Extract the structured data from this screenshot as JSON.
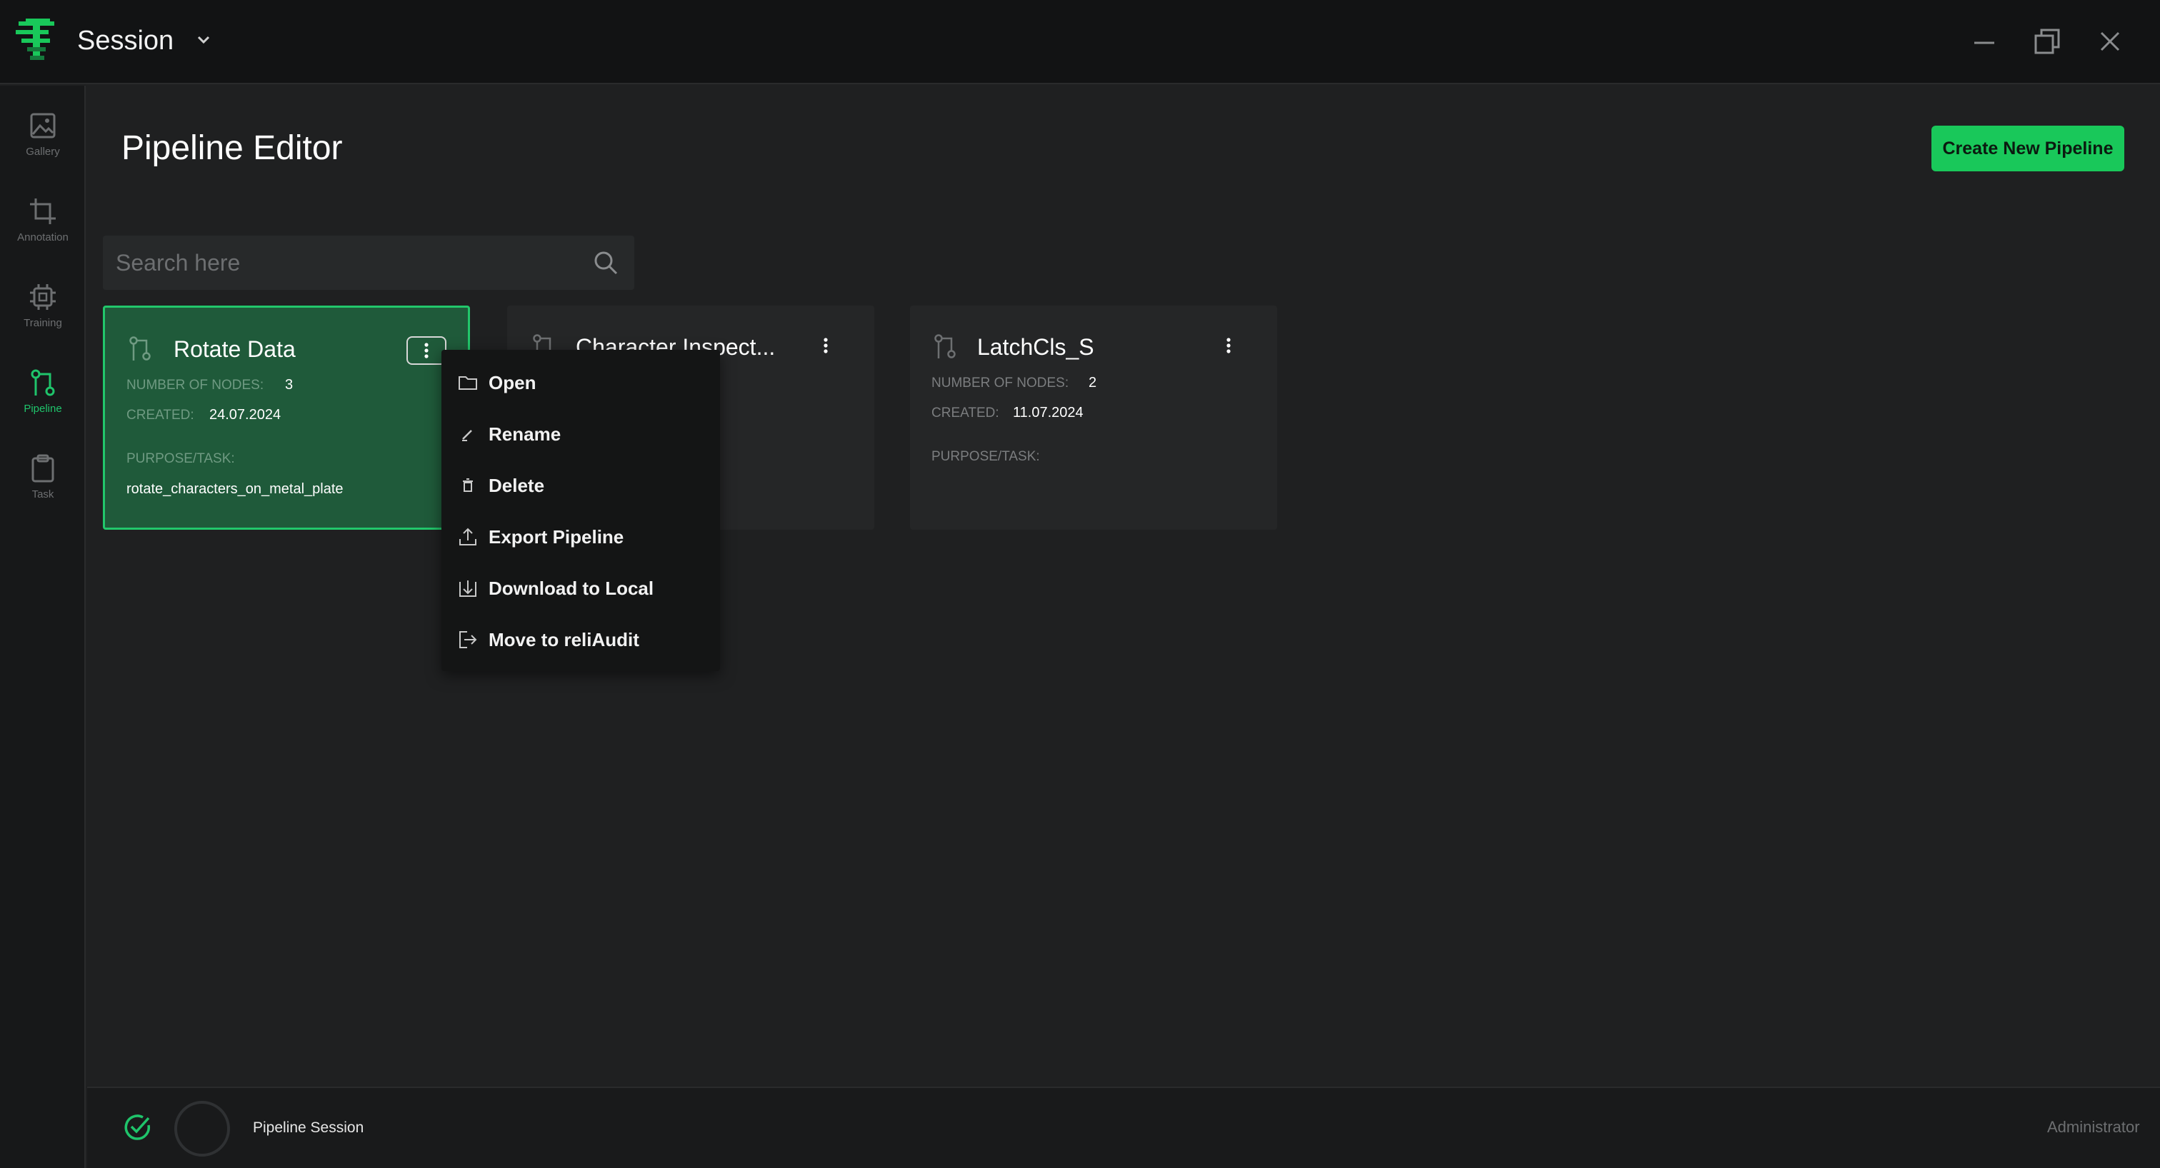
{
  "app": {
    "session_title": "Session",
    "brand_color": "#19c85a",
    "icons": {
      "logo": "app-logo-icon",
      "dropdown": "chevron-down-icon",
      "minimize": "minimize-icon",
      "restore": "restore-icon",
      "close": "close-icon"
    }
  },
  "sidebar": {
    "items": [
      {
        "label": "Gallery",
        "icon": "image-icon",
        "active": false
      },
      {
        "label": "Annotation",
        "icon": "crop-icon",
        "active": false
      },
      {
        "label": "Training",
        "icon": "chip-icon",
        "active": false
      },
      {
        "label": "Pipeline",
        "icon": "pipeline-icon",
        "active": true
      },
      {
        "label": "Task",
        "icon": "clipboard-icon",
        "active": false
      }
    ]
  },
  "main": {
    "title": "Pipeline Editor",
    "create_button": "Create New Pipeline",
    "search": {
      "placeholder": "Search here",
      "value": "",
      "icon": "search-icon"
    }
  },
  "cards": [
    {
      "name": "Rotate Data",
      "nodes_label": "NUMBER OF NODES:",
      "nodes": "3",
      "created_label": "CREATED:",
      "created": "24.07.2024",
      "purpose_label": "PURPOSE/TASK:",
      "purpose": "rotate_characters_on_metal_plate",
      "selected": true
    },
    {
      "name": "Character Inspect...",
      "selected": false
    },
    {
      "name": "LatchCls_S",
      "nodes_label": "NUMBER OF NODES:",
      "nodes": "2",
      "created_label": "CREATED:",
      "created": "11.07.2024",
      "purpose_label": "PURPOSE/TASK:",
      "purpose": "",
      "selected": false
    }
  ],
  "context_menu": {
    "items": [
      {
        "label": "Open",
        "icon": "folder-icon"
      },
      {
        "label": "Rename",
        "icon": "pencil-icon"
      },
      {
        "label": "Delete",
        "icon": "trash-icon"
      },
      {
        "label": "Export Pipeline",
        "icon": "upload-icon"
      },
      {
        "label": "Download to Local",
        "icon": "download-icon"
      },
      {
        "label": "Move to reliAudit",
        "icon": "move-out-icon"
      }
    ]
  },
  "footer": {
    "session_label": "Pipeline Session",
    "user": "Administrator",
    "status_icon": "check-circle-icon"
  }
}
